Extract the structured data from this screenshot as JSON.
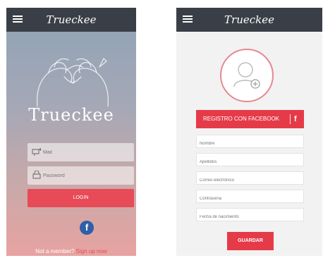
{
  "app": {
    "title": "Trueckee",
    "brand": "Trueckee"
  },
  "login": {
    "mail_placeholder": "Mail",
    "password_placeholder": "Password",
    "login_label": "LOGIN",
    "facebook_glyph": "f",
    "footer_text": "Not a member?",
    "signup_link": "Sign up now"
  },
  "register": {
    "facebook_button": "REGISTRO CON FACEBOOK",
    "facebook_glyph": "f",
    "fields": [
      {
        "placeholder": "Nombre"
      },
      {
        "placeholder": "Apellidos"
      },
      {
        "placeholder": "Correo electrónico"
      },
      {
        "placeholder": "Contraseña"
      },
      {
        "placeholder": "Fecha de nacimiento"
      }
    ],
    "save_label": "GUARDAR"
  },
  "colors": {
    "accent": "#e53b49",
    "topbar": "#3a3f47",
    "facebook": "#2f5fa7"
  },
  "icons": [
    "menu-icon",
    "mail-icon",
    "lock-icon",
    "facebook-icon",
    "add-photo-icon"
  ]
}
